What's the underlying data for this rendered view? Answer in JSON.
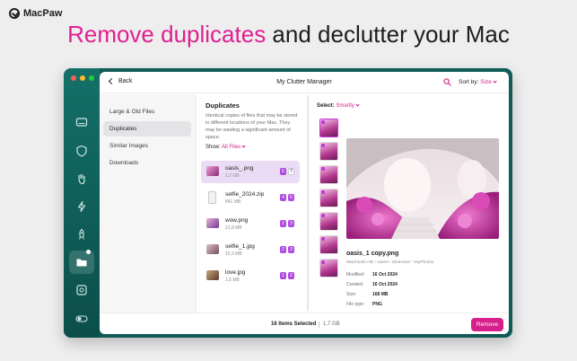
{
  "brand": {
    "name": "MacPaw"
  },
  "headline": {
    "highlight": "Remove duplicates",
    "rest": " and declutter your Mac"
  },
  "window": {
    "title": "My Clutter Manager",
    "back_label": "Back",
    "sort_label": "Sort by:",
    "sort_value": "Size",
    "traffic_lights": [
      "#ff5f57",
      "#febc2e",
      "#28c840"
    ]
  },
  "sidebar_rail": {
    "icons": [
      "disk-icon",
      "shield-icon",
      "hand-icon",
      "bolt-icon",
      "rocket-icon",
      "folder-icon",
      "finder-icon",
      "toggle-icon"
    ]
  },
  "categories": {
    "items": [
      {
        "label": "Large & Old Files"
      },
      {
        "label": "Duplicates"
      },
      {
        "label": "Similar Images"
      },
      {
        "label": "Downloads"
      }
    ]
  },
  "duplicates": {
    "heading": "Duplicates",
    "description": "Identical copies of files that may be stored in different locations of your Mac. They may be wasting a significant amount of space.",
    "show_label": "Show:",
    "show_value": "All Files",
    "files": [
      {
        "name": "oasis_.png",
        "size": "1,2 GB",
        "selected_count": "6",
        "total_count": "7"
      },
      {
        "name": "selfie_2024.zip",
        "size": "841 MB",
        "selected_count": "4",
        "total_count": "5"
      },
      {
        "name": "wow.png",
        "size": "21,8 MB",
        "selected_count": "2",
        "total_count": "3"
      },
      {
        "name": "selfie_1.jpg",
        "size": "15,3 MB",
        "selected_count": "2",
        "total_count": "3"
      },
      {
        "name": "love.jpg",
        "size": "1,6 MB",
        "selected_count": "1",
        "total_count": "2"
      }
    ]
  },
  "preview": {
    "select_label": "Select:",
    "select_value": "Smartly",
    "file_name": "oasis_1 copy.png",
    "path": "Macintosh HD › Users › MainUser › MyPhotos",
    "meta": [
      {
        "key": "Modified:",
        "value": "16 Oct 2024"
      },
      {
        "key": "Created:",
        "value": "16 Oct 2024"
      },
      {
        "key": "Size:",
        "value": "168 MB"
      },
      {
        "key": "File type:",
        "value": "PNG"
      }
    ]
  },
  "footer": {
    "items_selected": "16 Items Selected",
    "selected_size": "1,7 GB",
    "remove_label": "Remove"
  },
  "colors": {
    "accent": "#d6208b",
    "rail": "#0f5b57",
    "selection": "#eadcf5"
  }
}
